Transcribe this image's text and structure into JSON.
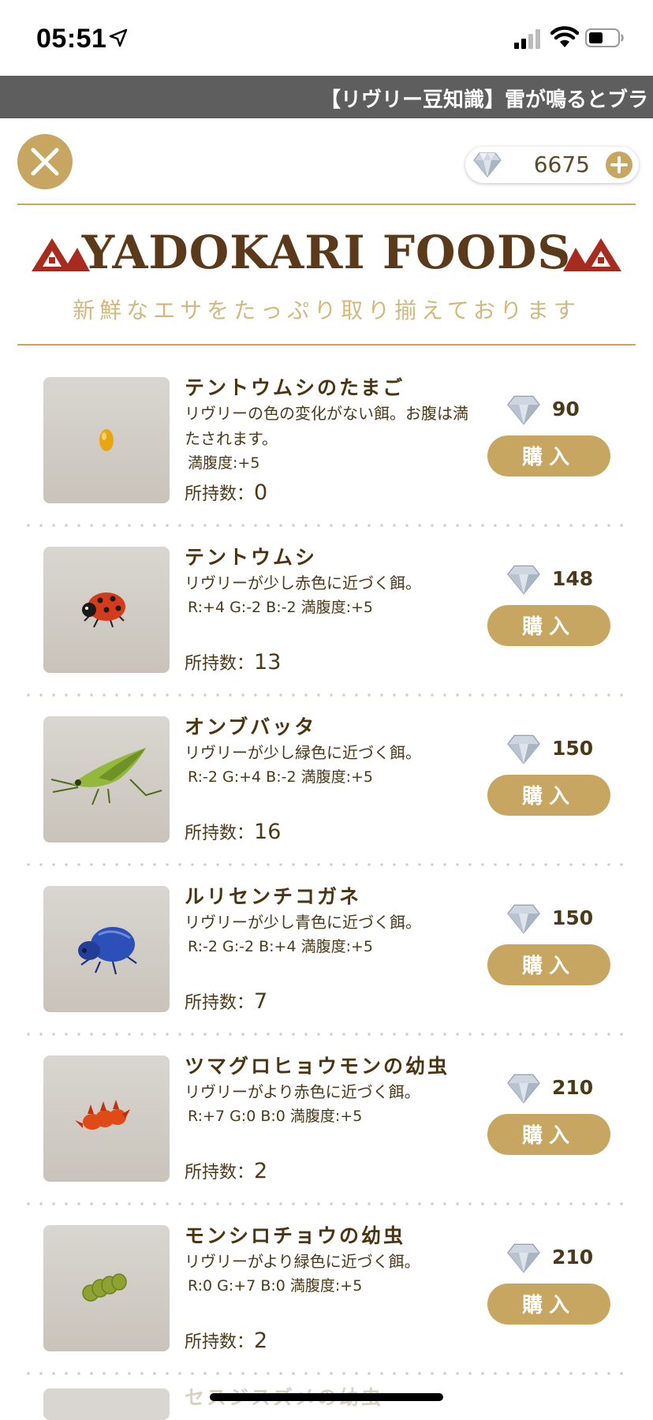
{
  "status": {
    "time": "05:51"
  },
  "ticker": {
    "text": "【リヴリー豆知識】雷が鳴るとブラ"
  },
  "header": {
    "gem_count": "6675"
  },
  "logo": {
    "title": "YADOKARI FOODS",
    "subtitle": "新鮮なエサをたっぷり取り揃えております"
  },
  "colors": {
    "accent": "#c6a661",
    "ticker_bg": "#5e5e5e",
    "text": "#4a3a1a"
  },
  "items": [
    {
      "name": "テントウムシのたまご",
      "desc": "リヴリーの色の変化がない餌。お腹は満たされます。",
      "stats": "満腹度:+5",
      "owned_label": "所持数：",
      "owned": "0",
      "price": "90",
      "buy": "購入",
      "image": "ladybug-egg-icon"
    },
    {
      "name": "テントウムシ",
      "desc": "リヴリーが少し赤色に近づく餌。",
      "stats": "R:+4 G:-2 B:-2 満腹度:+5",
      "owned_label": "所持数：",
      "owned": "13",
      "price": "148",
      "buy": "購入",
      "image": "ladybug-icon"
    },
    {
      "name": "オンブバッタ",
      "desc": "リヴリーが少し緑色に近づく餌。",
      "stats": "R:-2 G:+4 B:-2 満腹度:+5",
      "owned_label": "所持数：",
      "owned": "16",
      "price": "150",
      "buy": "購入",
      "image": "grasshopper-icon"
    },
    {
      "name": "ルリセンチコガネ",
      "desc": "リヴリーが少し青色に近づく餌。",
      "stats": "R:-2 G:-2 B:+4 満腹度:+5",
      "owned_label": "所持数：",
      "owned": "7",
      "price": "150",
      "buy": "購入",
      "image": "blue-beetle-icon"
    },
    {
      "name": "ツマグロヒョウモンの幼虫",
      "desc": "リヴリーがより赤色に近づく餌。",
      "stats": "R:+7 G:0 B:0 満腹度:+5",
      "owned_label": "所持数：",
      "owned": "2",
      "price": "210",
      "buy": "購入",
      "image": "red-caterpillar-icon"
    },
    {
      "name": "モンシロチョウの幼虫",
      "desc": "リヴリーがより緑色に近づく餌。",
      "stats": "R:0 G:+7 B:0 満腹度:+5",
      "owned_label": "所持数：",
      "owned": "2",
      "price": "210",
      "buy": "購入",
      "image": "green-caterpillar-icon"
    }
  ],
  "next_item_peek": "セスジスズメの幼虫"
}
